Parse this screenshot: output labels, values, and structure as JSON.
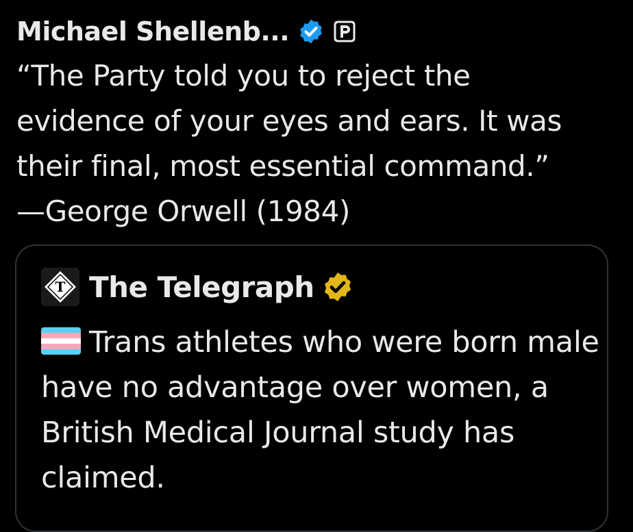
{
  "tweet": {
    "author_name": "Michael Shellenb...",
    "text": "“The Party told you to reject the\nevidence of your eyes and ears. It was\ntheir final, most essential command.”\n—George Orwell (1984)"
  },
  "quoted_tweet": {
    "author_name": "The Telegraph",
    "text": "Trans athletes who were born male have no advantage over women, a British Medical Journal study has claimed."
  },
  "icons": {
    "author_verified": "verified-badge-blue-icon",
    "author_affiliate": "p-letter-badge-icon",
    "quote_avatar": "telegraph-logo-icon",
    "quote_verified": "verified-badge-gold-icon",
    "flag": "transgender-flag-icon"
  },
  "colors": {
    "background": "#000000",
    "text": "#e7e9ea",
    "verified_blue": "#1d9bf0",
    "verified_gold": "#e2b719",
    "card_border": "#2f3336",
    "flag_blue": "#5bcefa",
    "flag_pink": "#f5a9b8",
    "flag_white": "#ffffff"
  }
}
